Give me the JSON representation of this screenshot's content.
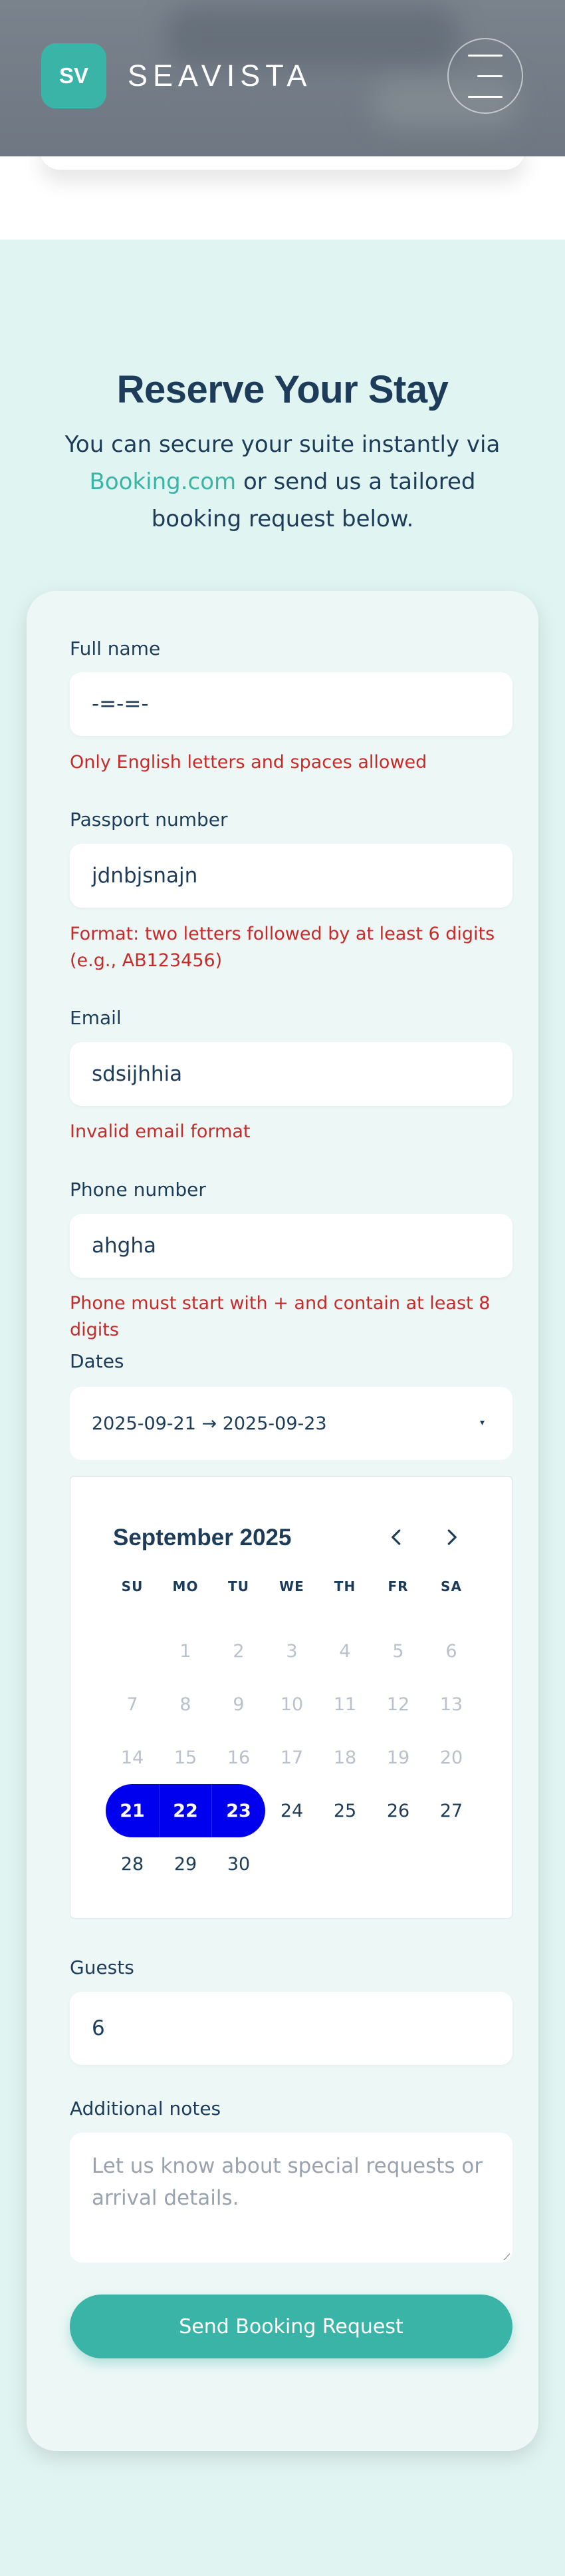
{
  "header": {
    "logo_text": "SV",
    "brand": "SEAVISTA",
    "menu_icon": "hamburger-icon"
  },
  "hero": {
    "title": "Reserve Your Stay",
    "subtitle_before": "You can secure your suite instantly via ",
    "subtitle_link": "Booking.com",
    "subtitle_after": " or send us a tailored booking request below."
  },
  "form": {
    "full_name": {
      "label": "Full name",
      "value": "-=-=-",
      "error": "Only English letters and spaces allowed"
    },
    "passport": {
      "label": "Passport number",
      "value": "jdnbjsnajn",
      "error": "Format: two letters followed by at least 6 digits (e.g., AB123456)"
    },
    "email": {
      "label": "Email",
      "value": "sdsijhhia",
      "error": "Invalid email format"
    },
    "phone": {
      "label": "Phone number",
      "value": "ahgha",
      "error": "Phone must start with + and contain at least 8 digits"
    },
    "dates": {
      "label": "Dates",
      "value": "2025-09-21 → 2025-09-23",
      "caret": "▾"
    },
    "calendar": {
      "month": "September 2025",
      "prev_icon": "chevron-left-icon",
      "next_icon": "chevron-right-icon",
      "weekdays": [
        "SU",
        "MO",
        "TU",
        "WE",
        "TH",
        "FR",
        "SA"
      ],
      "weeks": [
        [
          "",
          "1",
          "2",
          "3",
          "4",
          "5",
          "6"
        ],
        [
          "7",
          "8",
          "9",
          "10",
          "11",
          "12",
          "13"
        ],
        [
          "14",
          "15",
          "16",
          "17",
          "18",
          "19",
          "20"
        ],
        [
          "21",
          "22",
          "23",
          "24",
          "25",
          "26",
          "27"
        ],
        [
          "28",
          "29",
          "30",
          "",
          "",
          "",
          ""
        ]
      ],
      "disabled_through": 20,
      "selected_start": 21,
      "selected_end": 23,
      "selection_color": "#0000ee"
    },
    "guests": {
      "label": "Guests",
      "value": "6"
    },
    "notes": {
      "label": "Additional notes",
      "placeholder": "Let us know about special requests or arrival details."
    },
    "submit_label": "Send Booking Request"
  },
  "colors": {
    "accent": "#3bb4a8",
    "text": "#1d3c5a",
    "error": "#c82a2a",
    "page_bg": "#e0f4f1"
  }
}
